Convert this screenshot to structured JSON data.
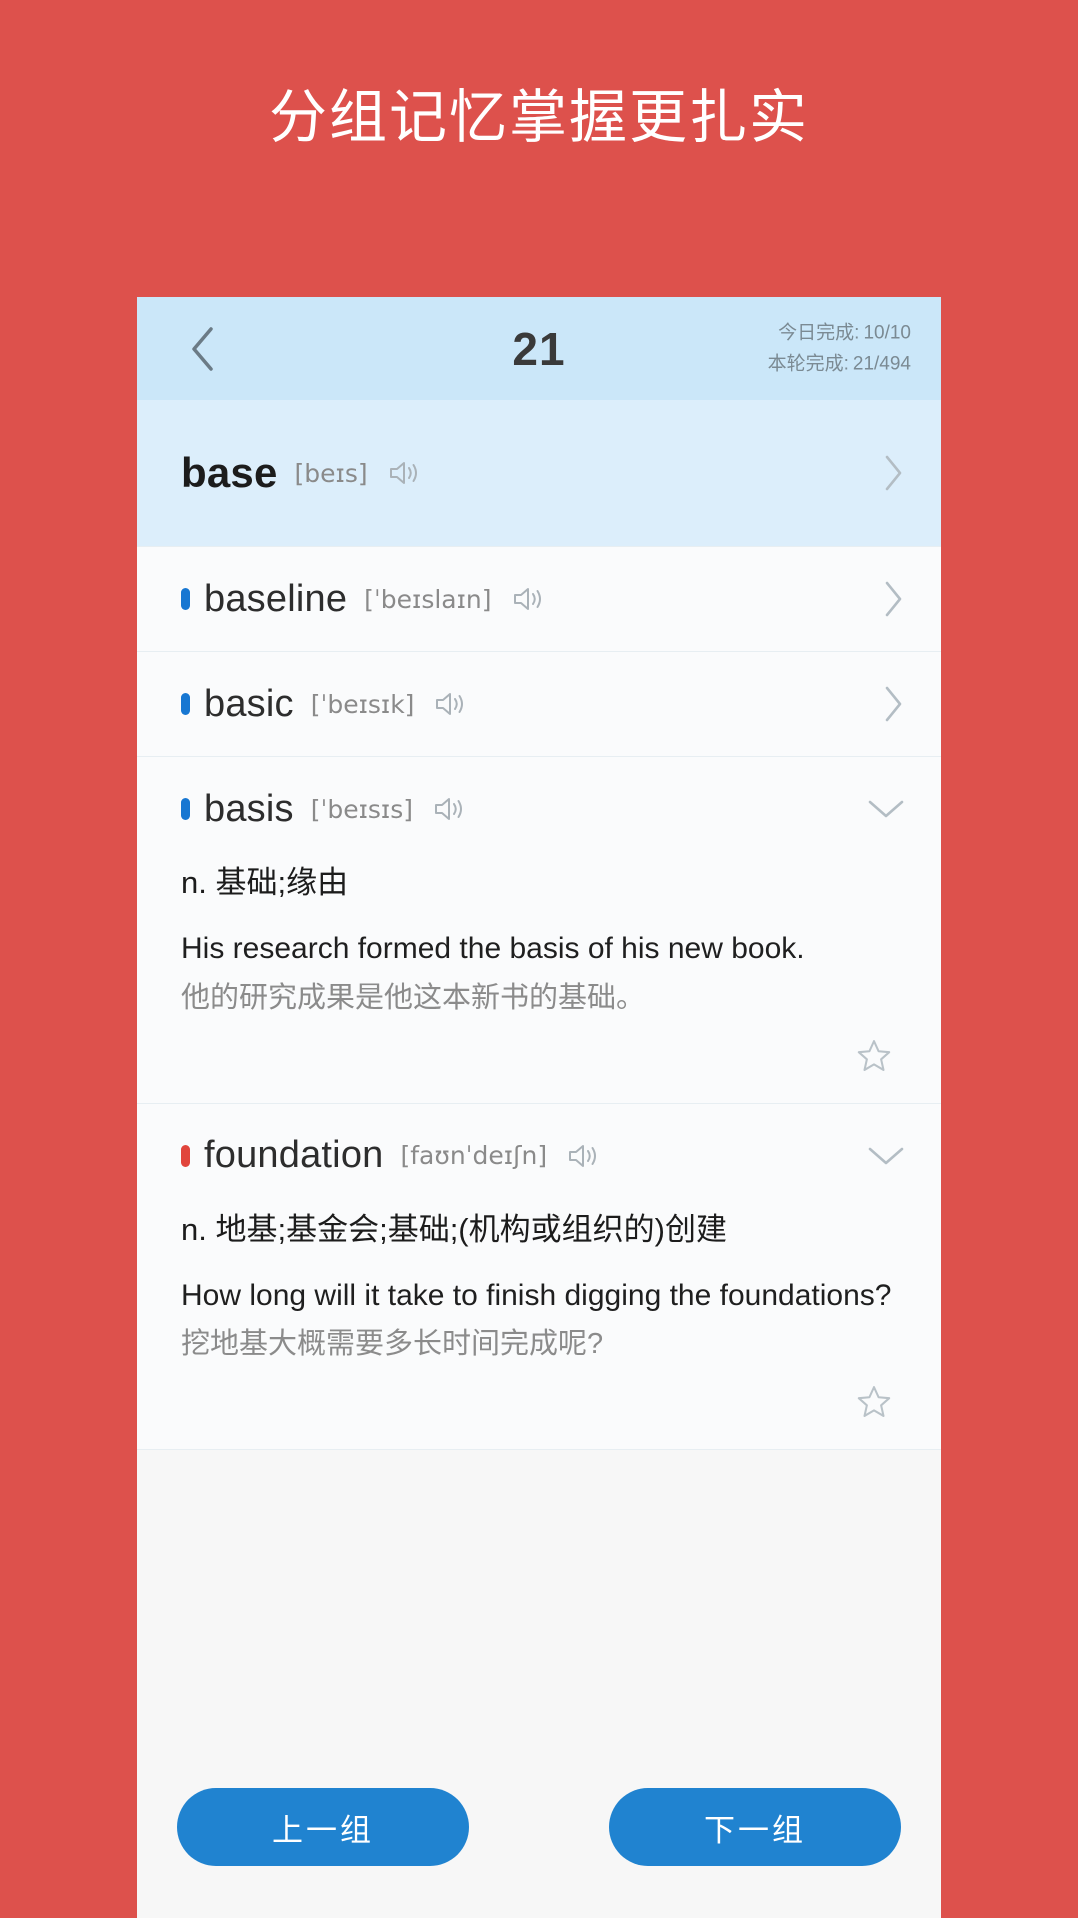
{
  "promo": {
    "title": "分组记忆掌握更扎实",
    "bg_color": "#dd514c"
  },
  "header": {
    "back_icon": "chevron-left-icon",
    "group_number": "21",
    "stats": [
      {
        "label": "今日完成:",
        "value": "10/10"
      },
      {
        "label": "本轮完成:",
        "value": "21/494"
      }
    ],
    "bg_color": "#cbe7f9"
  },
  "words": [
    {
      "word": "base",
      "phonetic": "[beɪs]",
      "marker": "none",
      "state": "current",
      "expanded": false,
      "chevron": "chevron-right-icon",
      "sound_icon": "speaker-icon"
    },
    {
      "word": "baseline",
      "phonetic": "[ˈbeɪslaɪn]",
      "marker": "blue",
      "state": "normal",
      "expanded": false,
      "chevron": "chevron-right-icon",
      "sound_icon": "speaker-icon"
    },
    {
      "word": "basic",
      "phonetic": "[ˈbeɪsɪk]",
      "marker": "blue",
      "state": "normal",
      "expanded": false,
      "chevron": "chevron-right-icon",
      "sound_icon": "speaker-icon"
    },
    {
      "word": "basis",
      "phonetic": "[ˈbeɪsɪs]",
      "marker": "blue",
      "state": "normal",
      "expanded": true,
      "chevron": "chevron-down-icon",
      "sound_icon": "speaker-icon",
      "definition": "n. 基础;缘由",
      "example_en": "His research formed the basis of his new book.",
      "example_cn": "他的研究成果是他这本新书的基础。",
      "star_icon": "star-outline-icon"
    },
    {
      "word": "foundation",
      "phonetic": "[faʊnˈdeɪʃn]",
      "marker": "red",
      "state": "normal",
      "expanded": true,
      "chevron": "chevron-down-icon",
      "sound_icon": "speaker-icon",
      "definition": "n. 地基;基金会;基础;(机构或组织的)创建",
      "example_en": "How long will it take to finish digging the foundations?",
      "example_cn": "挖地基大概需要多长时间完成呢?",
      "star_icon": "star-outline-icon"
    }
  ],
  "footer": {
    "prev_label": "上一组",
    "next_label": "下一组",
    "button_color": "#2083d0"
  },
  "colors": {
    "marker_blue": "#1777d2",
    "marker_red": "#e1453c",
    "accent": "#2083d0",
    "background_red": "#dd514c",
    "header_blue": "#cbe7f9"
  }
}
